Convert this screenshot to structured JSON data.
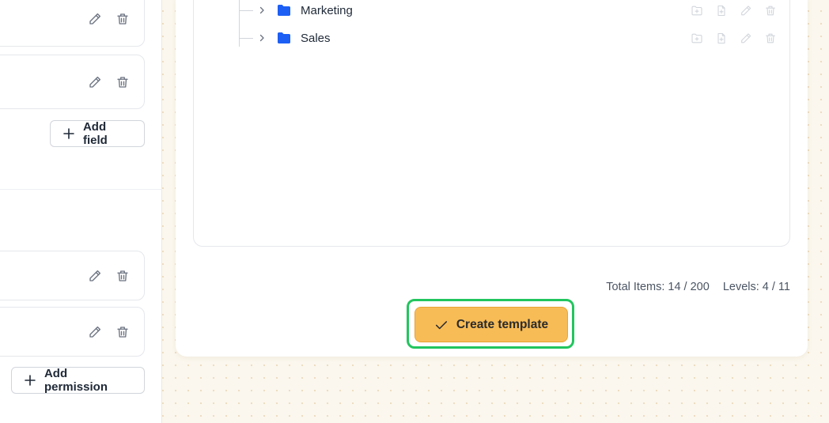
{
  "left_panel": {
    "add_field_label": "Add field",
    "add_permission_label": "Add permission",
    "card_icons": [
      "pencil-icon",
      "trash-icon"
    ]
  },
  "tree": {
    "items": [
      {
        "label": "Marketing",
        "icon": "folder-icon"
      },
      {
        "label": "Sales",
        "icon": "folder-icon"
      }
    ],
    "row_action_icons": [
      "folder-add-icon",
      "file-add-icon",
      "pencil-icon",
      "trash-icon"
    ]
  },
  "stats": {
    "total_items": "Total Items: 14 / 200",
    "levels": "Levels: 4 / 11"
  },
  "create_button": {
    "label": "Create template",
    "icon": "check-icon"
  },
  "colors": {
    "folder": "#1d5ff5",
    "accent": "#f8bc57",
    "highlight_outline": "#22c55e",
    "background": "#fbf7ee"
  }
}
